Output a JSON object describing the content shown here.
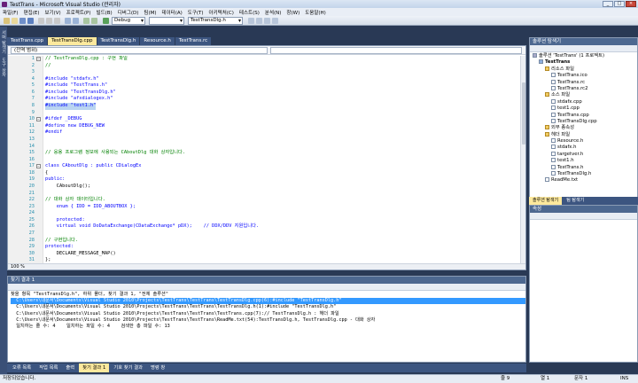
{
  "window": {
    "title": "TestTrans - Microsoft Visual Studio (관리자)",
    "buttons": [
      "_",
      "□",
      "×"
    ]
  },
  "menu": [
    "파일(F)",
    "편집(E)",
    "보기(V)",
    "프로젝트(P)",
    "빌드(B)",
    "디버그(D)",
    "팀(M)",
    "데이터(A)",
    "도구(T)",
    "아키텍처(C)",
    "테스트(S)",
    "분석(N)",
    "창(W)",
    "도움말(H)"
  ],
  "toolbar": {
    "config": "Debug",
    "find_target": "TestTransDlg.h"
  },
  "left_tabs": [
    "서버 탐색기",
    "도구 상자"
  ],
  "doc_tabs": [
    "TestTrans.cpp",
    "TestTransDlg.cpp",
    "TestTransDlg.h",
    "Resource.h",
    "TestTrans.rc"
  ],
  "editor": {
    "nav_scope": "(전역 범위)",
    "zoom": "100 %",
    "lines": [
      {
        "n": "1",
        "t": "// TestTransDlg.cpp : 구현 파일",
        "c": "cm",
        "m": "−"
      },
      {
        "n": "2",
        "t": "//",
        "c": "cm"
      },
      {
        "n": "3",
        "t": ""
      },
      {
        "n": "4",
        "t": "#include \"stdafx.h\"",
        "c": "pp"
      },
      {
        "n": "5",
        "t": "#include \"TestTrans.h\"",
        "c": "pp"
      },
      {
        "n": "6",
        "t": "#include \"TestTransDlg.h\"",
        "c": "pp"
      },
      {
        "n": "7",
        "t": "#include \"afxdialogex.h\"",
        "c": "pp"
      },
      {
        "n": "8",
        "t": "#include \"test1.h\"",
        "c": "pp",
        "sel": true
      },
      {
        "n": "9",
        "t": ""
      },
      {
        "n": "10",
        "t": "#ifdef _DEBUG",
        "c": "pp",
        "m": "−"
      },
      {
        "n": "11",
        "t": "#define new DEBUG_NEW",
        "c": "pp"
      },
      {
        "n": "12",
        "t": "#endif",
        "c": "pp"
      },
      {
        "n": "13",
        "t": ""
      },
      {
        "n": "14",
        "t": ""
      },
      {
        "n": "15",
        "t": "// 응용 프로그램 정보에 사용되는 CAboutDlg 대화 상자입니다.",
        "c": "cm"
      },
      {
        "n": "16",
        "t": ""
      },
      {
        "n": "17",
        "t": "class CAboutDlg : public CDialogEx",
        "c": "kw",
        "m": "−"
      },
      {
        "n": "18",
        "t": "{"
      },
      {
        "n": "19",
        "t": "public:",
        "c": "kw"
      },
      {
        "n": "20",
        "t": "    CAboutDlg();"
      },
      {
        "n": "21",
        "t": ""
      },
      {
        "n": "22",
        "t": "// 대화 상자 데이터입니다.",
        "c": "cm"
      },
      {
        "n": "23",
        "t": "    enum { IDD = IDD_ABOUTBOX };",
        "c": "kw"
      },
      {
        "n": "24",
        "t": ""
      },
      {
        "n": "25",
        "t": "    protected:",
        "c": "kw"
      },
      {
        "n": "26",
        "t": "    virtual void DoDataExchange(CDataExchange* pDX);    // DDX/DDV 지원입니다.",
        "c": "kw"
      },
      {
        "n": "27",
        "t": ""
      },
      {
        "n": "28",
        "t": "// 구현입니다.",
        "c": "cm"
      },
      {
        "n": "29",
        "t": "protected:",
        "c": "kw"
      },
      {
        "n": "30",
        "t": "    DECLARE_MESSAGE_MAP()"
      },
      {
        "n": "31",
        "t": "};"
      },
      {
        "n": "32",
        "t": ""
      },
      {
        "n": "33",
        "t": "CAboutDlg::CAboutDlg() : CDialogEx(CAboutDlg::IDD)",
        "m": "−"
      },
      {
        "n": "34",
        "t": "{"
      }
    ]
  },
  "solution": {
    "title": "솔루션 탐색기",
    "items": [
      {
        "d": 0,
        "t": "솔루션 'TestTrans' (1 프로젝트)",
        "i": "sol"
      },
      {
        "d": 1,
        "t": "TestTrans",
        "i": "proj",
        "b": true
      },
      {
        "d": 2,
        "t": "리소스 파일",
        "i": "folder"
      },
      {
        "d": 3,
        "t": "TestTrans.ico",
        "i": "file"
      },
      {
        "d": 3,
        "t": "TestTrans.rc",
        "i": "file"
      },
      {
        "d": 3,
        "t": "TestTrans.rc2",
        "i": "file"
      },
      {
        "d": 2,
        "t": "소스 파일",
        "i": "folder"
      },
      {
        "d": 3,
        "t": "stdafx.cpp",
        "i": "file"
      },
      {
        "d": 3,
        "t": "test1.cpp",
        "i": "file"
      },
      {
        "d": 3,
        "t": "TestTrans.cpp",
        "i": "file"
      },
      {
        "d": 3,
        "t": "TestTransDlg.cpp",
        "i": "file"
      },
      {
        "d": 2,
        "t": "외부 종속성",
        "i": "folder"
      },
      {
        "d": 2,
        "t": "헤더 파일",
        "i": "folder"
      },
      {
        "d": 3,
        "t": "Resource.h",
        "i": "file"
      },
      {
        "d": 3,
        "t": "stdafx.h",
        "i": "file"
      },
      {
        "d": 3,
        "t": "targetver.h",
        "i": "file"
      },
      {
        "d": 3,
        "t": "test1.h",
        "i": "file"
      },
      {
        "d": 3,
        "t": "TestTrans.h",
        "i": "file"
      },
      {
        "d": 3,
        "t": "TestTransDlg.h",
        "i": "file"
      },
      {
        "d": 2,
        "t": "ReadMe.txt",
        "i": "file"
      }
    ],
    "tabs": [
      "솔루션 탐색기",
      "팀 탐색기"
    ]
  },
  "properties": {
    "title": "속성"
  },
  "output": {
    "title": "찾기 결과 1",
    "lines": [
      "찾을 항목 \"TestTransDlg.h\", 하위 폴더, 찾기 결과 1, \"전체 솔루션\"",
      "  C:\\Users\\내문서\\Documents\\Visual Studio 2010\\Projects\\TestTrans\\TestTrans\\TestTransDlg.cpp(6):#include \"TestTransDlg.h\"",
      "  C:\\Users\\내문서\\Documents\\Visual Studio 2010\\Projects\\TestTrans\\TestTrans\\TestTransDlg.h(1):#include \"TestTransDlg.h\"",
      "  C:\\Users\\내문서\\Documents\\Visual Studio 2010\\Projects\\TestTrans\\TestTrans\\TestTrans.cpp(7):// TestTransDlg.h : 헤더 파일",
      "  C:\\Users\\내문서\\Documents\\Visual Studio 2010\\Projects\\TestTrans\\TestTrans\\ReadMe.txt(54):TestTransDlg.h, TestTransDlg.cpp - 대화 상자",
      "  일치하는 줄 수: 4    일치하는 파일 수: 4    검색한 총 파일 수: 13"
    ],
    "highlight_index": 1
  },
  "bottom_tabs": [
    "오류 목록",
    "작업 목록",
    "출력",
    "찾기 결과 1",
    "기호 찾기 결과",
    "명령 창"
  ],
  "status": {
    "left": "저장되었습니다.",
    "ln": "줄 9",
    "col": "열 1",
    "ch": "문자 1",
    "mode": "INS"
  }
}
